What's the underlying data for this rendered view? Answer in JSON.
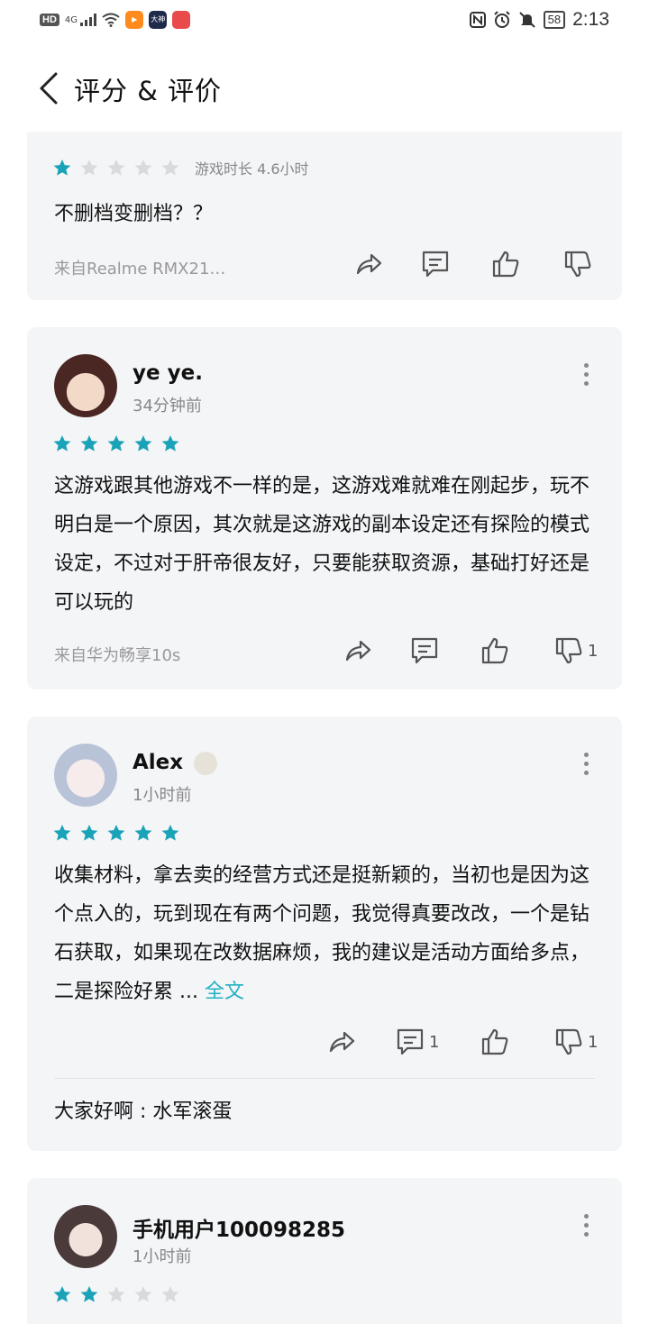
{
  "status_bar": {
    "hd": "HD",
    "network": "4G",
    "time": "2:13",
    "battery": "58",
    "app_icons": [
      "video-app-icon",
      "dashen-app-icon",
      "huawei-app-icon"
    ],
    "dashen_label": "大神"
  },
  "header": {
    "title": "评分 & 评价"
  },
  "colors": {
    "accent": "#23b1c3",
    "star_on": "#1aa3b8",
    "star_off": "#d9dadc",
    "card_bg": "#f4f5f7"
  },
  "reviews": [
    {
      "rating": 1,
      "playtime": "游戏时长 4.6小时",
      "text": "不删档变删档？？",
      "source": "来自Realme RMX21…",
      "share_count": "",
      "comment_count": "",
      "like_count": "",
      "dislike_count": ""
    },
    {
      "user": "ye ye.",
      "time": "34分钟前",
      "rating": 5,
      "text": "这游戏跟其他游戏不一样的是，这游戏难就难在刚起步，玩不明白是一个原因，其次就是这游戏的副本设定还有探险的模式设定，不过对于肝帝很友好，只要能获取资源，基础打好还是可以玩的",
      "source": "来自华为畅享10s",
      "comment_count": "",
      "like_count": "",
      "dislike_count": "1"
    },
    {
      "user": "Alex",
      "time": "1小时前",
      "rating": 5,
      "text": "收集材料，拿去卖的经营方式还是挺新颖的，当初也是因为这个点入的，玩到现在有两个问题，我觉得真要改改，一个是钻石获取，如果现在改数据麻烦，我的建议是活动方面给多点，二是探险好累 ...",
      "more_label": "全文",
      "comment_count": "1",
      "like_count": "",
      "dislike_count": "1",
      "reply_author": "大家好啊",
      "reply_text": "水军滚蛋"
    },
    {
      "user": "手机用户100098285",
      "time": "1小时前",
      "rating": 2
    }
  ]
}
